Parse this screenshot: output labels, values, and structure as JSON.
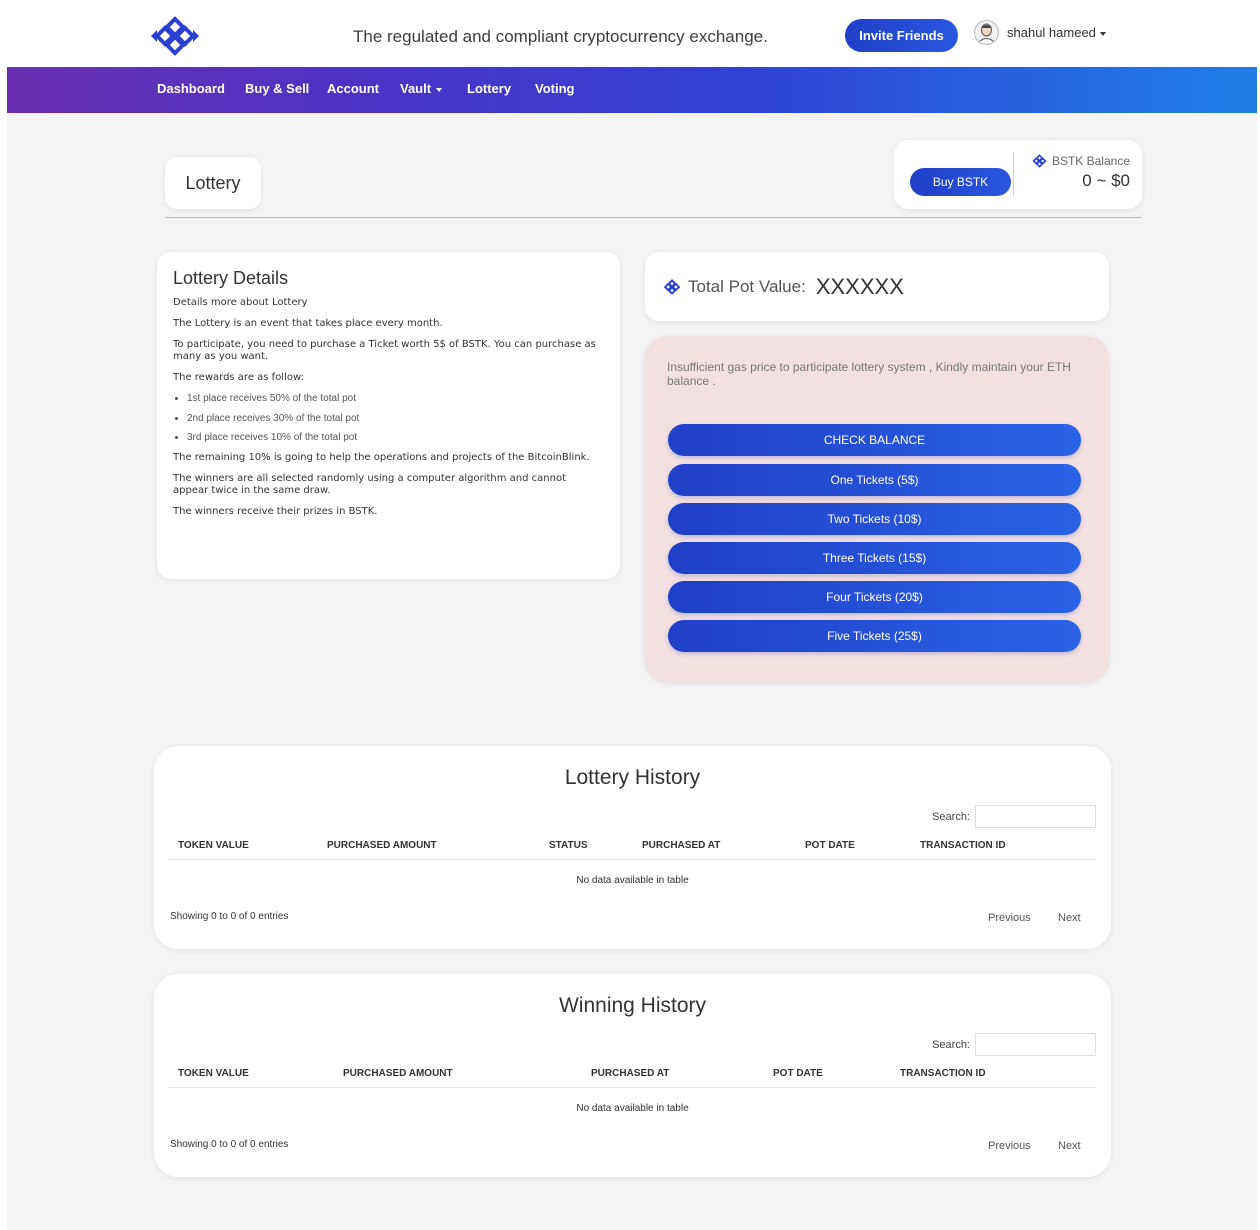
{
  "header": {
    "tagline": "The regulated and compliant cryptocurrency exchange.",
    "invite_label": "Invite Friends",
    "user_name": "shahul hameed",
    "brand_color": "#1f3fc7"
  },
  "nav": {
    "items": [
      {
        "label": "Dashboard"
      },
      {
        "label": "Buy & Sell"
      },
      {
        "label": "Account"
      },
      {
        "label": "Vault"
      },
      {
        "label": "Lottery"
      },
      {
        "label": "Voting"
      }
    ]
  },
  "page": {
    "title": "Lottery",
    "buy_label": "Buy BSTK",
    "balance_label": "BSTK Balance",
    "balance_value": "0 ~ $0"
  },
  "details": {
    "heading": "Lottery Details",
    "paragraphs_top": [
      "Details more about Lottery",
      "The Lottery is an event that takes place every month.",
      "To participate, you need to purchase a Ticket worth 5$ of BSTK. You can purchase as many as you want.",
      "The rewards are as follow:"
    ],
    "rewards": [
      "1st place receives 50% of the total pot",
      "2nd place receives 30% of the total pot",
      "3rd place receives 10% of the total pot"
    ],
    "paragraphs_bottom": [
      "The remaining 10% is going to help the operations and projects of the BitcoinBlink.",
      "The winners are all selected randomly using a computer algorithm and cannot appear twice in the same draw.",
      "The winners receive their prizes in BSTK."
    ]
  },
  "pot": {
    "label": "Total Pot Value:",
    "value": "XXXXXX"
  },
  "tickets": {
    "warning": "Insufficient gas price to participate lottery system , Kindly maintain your ETH balance .",
    "buttons": [
      {
        "label": "CHECK BALANCE"
      },
      {
        "label": "One Tickets (5$)"
      },
      {
        "label": "Two Tickets (10$)"
      },
      {
        "label": "Three Tickets (15$)"
      },
      {
        "label": "Four Tickets (20$)"
      },
      {
        "label": "Five Tickets (25$)"
      }
    ]
  },
  "lottery_history": {
    "title": "Lottery History",
    "search_label": "Search:",
    "columns": [
      "TOKEN VALUE",
      "PURCHASED AMOUNT",
      "STATUS",
      "PURCHASED AT",
      "POT DATE",
      "TRANSACTION ID"
    ],
    "empty_text": "No data available in table",
    "showing": "Showing 0 to 0 of 0 entries",
    "previous": "Previous",
    "next": "Next"
  },
  "winning_history": {
    "title": "Winning History",
    "search_label": "Search:",
    "columns": [
      "TOKEN VALUE",
      "PURCHASED AMOUNT",
      "PURCHASED AT",
      "POT DATE",
      "TRANSACTION ID"
    ],
    "empty_text": "No data available in table",
    "showing": "Showing 0 to 0 of 0 entries",
    "previous": "Previous",
    "next": "Next"
  }
}
